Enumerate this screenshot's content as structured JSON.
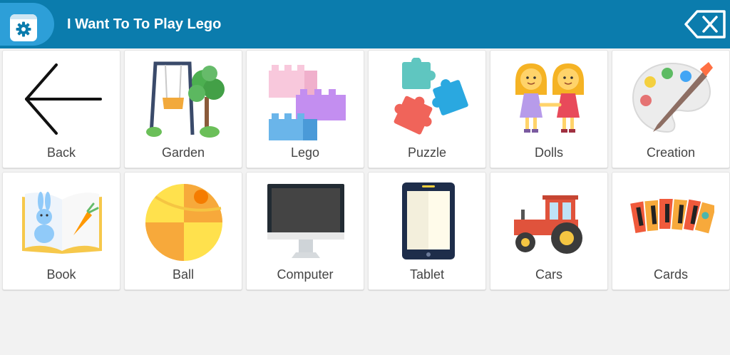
{
  "header": {
    "title": "I Want To To Play Lego",
    "settings_icon": "gear-icon",
    "delete_icon": "backspace-x-icon",
    "bar_color": "#0b7cad",
    "accent_color": "#2d9fd8"
  },
  "tiles": [
    {
      "label": "Back",
      "icon": "back-arrow-icon"
    },
    {
      "label": "Garden",
      "icon": "swing-tree-icon"
    },
    {
      "label": "Lego",
      "icon": "lego-bricks-icon"
    },
    {
      "label": "Puzzle",
      "icon": "puzzle-pieces-icon"
    },
    {
      "label": "Dolls",
      "icon": "two-dolls-icon"
    },
    {
      "label": "Creation",
      "icon": "paint-palette-icon"
    },
    {
      "label": "Book",
      "icon": "open-book-icon"
    },
    {
      "label": "Ball",
      "icon": "beach-ball-icon"
    },
    {
      "label": "Computer",
      "icon": "monitor-icon"
    },
    {
      "label": "Tablet",
      "icon": "tablet-icon"
    },
    {
      "label": "Cars",
      "icon": "tractor-icon"
    },
    {
      "label": "Cards",
      "icon": "playing-cards-icon"
    }
  ]
}
